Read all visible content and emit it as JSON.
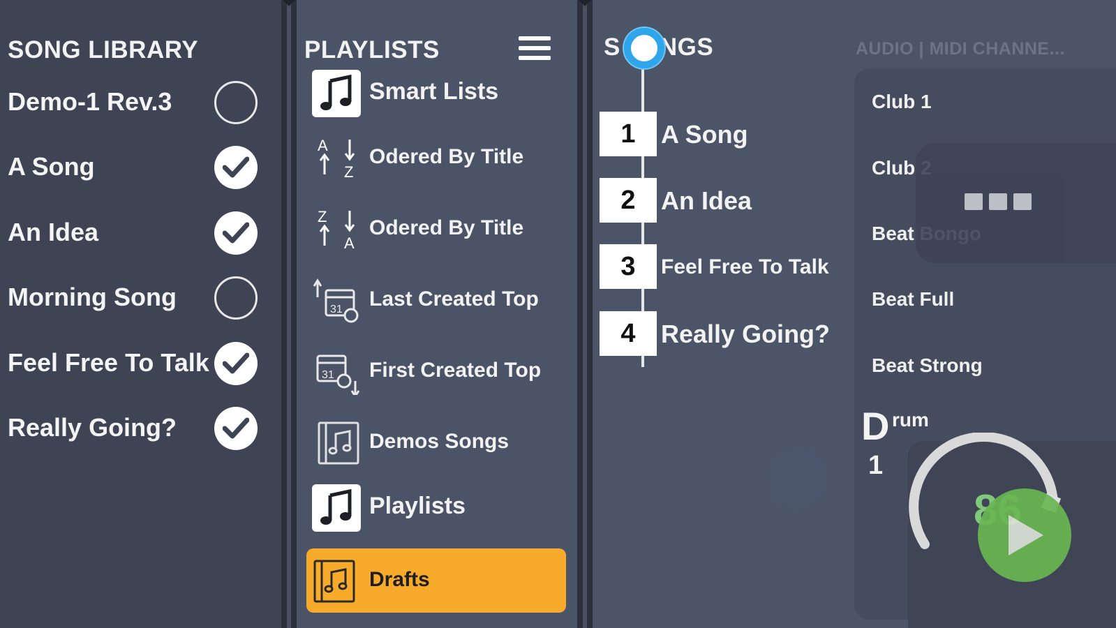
{
  "library": {
    "title": "SONG LIBRARY",
    "items": [
      {
        "name": "Demo-1 Rev.3",
        "checked": false
      },
      {
        "name": "A Song",
        "checked": true
      },
      {
        "name": "An Idea",
        "checked": true
      },
      {
        "name": "Morning Song",
        "checked": false
      },
      {
        "name": "Feel Free To Talk",
        "checked": true
      },
      {
        "name": "Really Going?",
        "checked": true
      }
    ]
  },
  "playlists": {
    "title": "PLAYLISTS",
    "menu_icon": "hamburger-menu-icon",
    "items": [
      {
        "label": "Smart Lists",
        "icon": "music-note-icon",
        "kind": "section"
      },
      {
        "label": "Odered By Title",
        "icon": "sort-a-to-z-icon",
        "kind": "item"
      },
      {
        "label": "Odered By Title",
        "icon": "sort-z-to-a-icon",
        "kind": "item"
      },
      {
        "label": "Last Created Top",
        "icon": "calendar-up-icon",
        "kind": "item"
      },
      {
        "label": "First Created Top",
        "icon": "calendar-down-icon",
        "kind": "item"
      },
      {
        "label": "Demos Songs",
        "icon": "playlist-icon",
        "kind": "item"
      },
      {
        "label": "Playlists",
        "icon": "music-note-icon",
        "kind": "section"
      },
      {
        "label": "Drafts",
        "icon": "playlist-icon",
        "kind": "item",
        "active": true
      }
    ]
  },
  "songs": {
    "title_s": "S",
    "title_rest": "NGS",
    "items": [
      {
        "num": "1",
        "title": "A Song"
      },
      {
        "num": "2",
        "title": "An Idea"
      },
      {
        "num": "3",
        "title": "Feel Free To Talk"
      },
      {
        "num": "4",
        "title": "Really Going?"
      }
    ]
  },
  "channels": {
    "header": "AUDIO | MIDI CHANNE...",
    "items": [
      "Club 1",
      "Club 2",
      "Beat Bongo",
      "Beat Full",
      "Beat Strong"
    ]
  },
  "drum": {
    "label_first": "D",
    "label_rest": "rum",
    "number": "1",
    "tempo": "86"
  },
  "colors": {
    "accent": "#f8aa2b",
    "timeline": "#2fa6ea",
    "play": "#6ab652"
  }
}
